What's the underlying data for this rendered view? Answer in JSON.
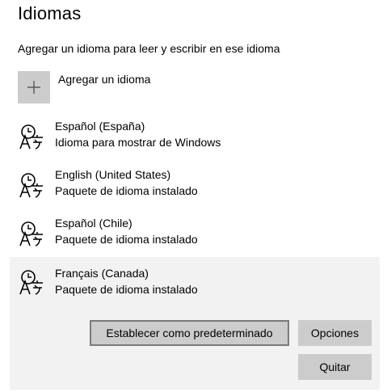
{
  "page": {
    "title": "Idiomas"
  },
  "intro": "Agregar un idioma para leer y escribir en ese idioma",
  "add_language": {
    "label": "Agregar un idioma",
    "icon": "plus-icon"
  },
  "languages": [
    {
      "name": "Español (España)",
      "status": "Idioma para mostrar de Windows",
      "icon": "language-icon"
    },
    {
      "name": "English (United States)",
      "status": "Paquete de idioma instalado",
      "icon": "language-icon"
    },
    {
      "name": "Español (Chile)",
      "status": "Paquete de idioma instalado",
      "icon": "language-icon"
    },
    {
      "name": "Français (Canada)",
      "status": "Paquete de idioma instalado",
      "icon": "language-icon",
      "selected": true
    }
  ],
  "actions": {
    "set_default": "Establecer como predeterminado",
    "options": "Opciones",
    "remove": "Quitar"
  },
  "colors": {
    "button_bg": "#cccccc",
    "selected_bg": "#f2f2f2",
    "focus_border": "#7a7a7a"
  }
}
